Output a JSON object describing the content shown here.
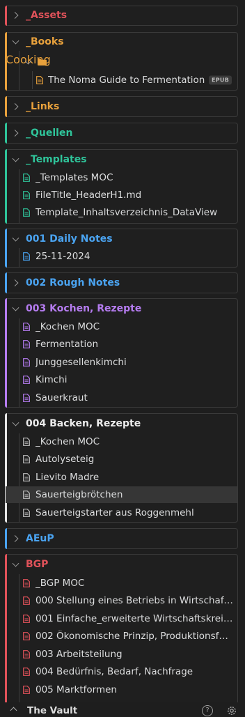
{
  "colors": {
    "assets": "#e0525a",
    "books": "#e8a13c",
    "links": "#e8a13c",
    "quellen": "#2fc49a",
    "templates": "#2fc49a",
    "daily": "#4aa3f0",
    "rough": "#4aa3f0",
    "kochen": "#b57cf0",
    "backen": "#e6e6e6",
    "aeup": "#4aa3f0",
    "bgp": "#e0525a"
  },
  "assets": {
    "name": "_Assets"
  },
  "books": {
    "name": "_Books",
    "subfolder": {
      "name": "Cooking",
      "icon": "folder-icon"
    },
    "file": {
      "label": "The Noma Guide to Fermentation",
      "badge": "EPUB"
    }
  },
  "links": {
    "name": "_Links"
  },
  "quellen": {
    "name": "_Quellen"
  },
  "templates": {
    "name": "_Templates",
    "items": [
      "_Templates MOC",
      "FileTitle_HeaderH1.md",
      "Template_Inhaltsverzeichnis_DataView"
    ]
  },
  "daily": {
    "name": "001 Daily Notes",
    "items": [
      "25-11-2024"
    ]
  },
  "rough": {
    "name": "002 Rough Notes"
  },
  "kochen": {
    "name": "003 Kochen, Rezepte",
    "items": [
      "_Kochen MOC",
      "Fermentation",
      "Junggesellenkimchi",
      "Kimchi",
      "Sauerkraut"
    ]
  },
  "backen": {
    "name": "004 Backen, Rezepte",
    "items": [
      "_Kochen MOC",
      "Autolyseteig",
      "Lievito Madre",
      "Sauerteigbrötchen",
      "Sauerteigstarter aus Roggenmehl"
    ]
  },
  "aeup": {
    "name": "AEuP"
  },
  "bgp": {
    "name": "BGP",
    "items": [
      "_BGP MOC",
      "000 Stellung eines Betriebs in Wirtschaft ...",
      "001 Einfache_erweiterte Wirtschaftskreisla...",
      "002 Ökonomische Prinzip, Produktionsfak...",
      "003 Arbeitsteilung",
      "004 Bedürfnis, Bedarf, Nachfrage",
      "005 Marktformen"
    ]
  },
  "footer": {
    "vault_name": "The Vault",
    "help_label": "?"
  }
}
